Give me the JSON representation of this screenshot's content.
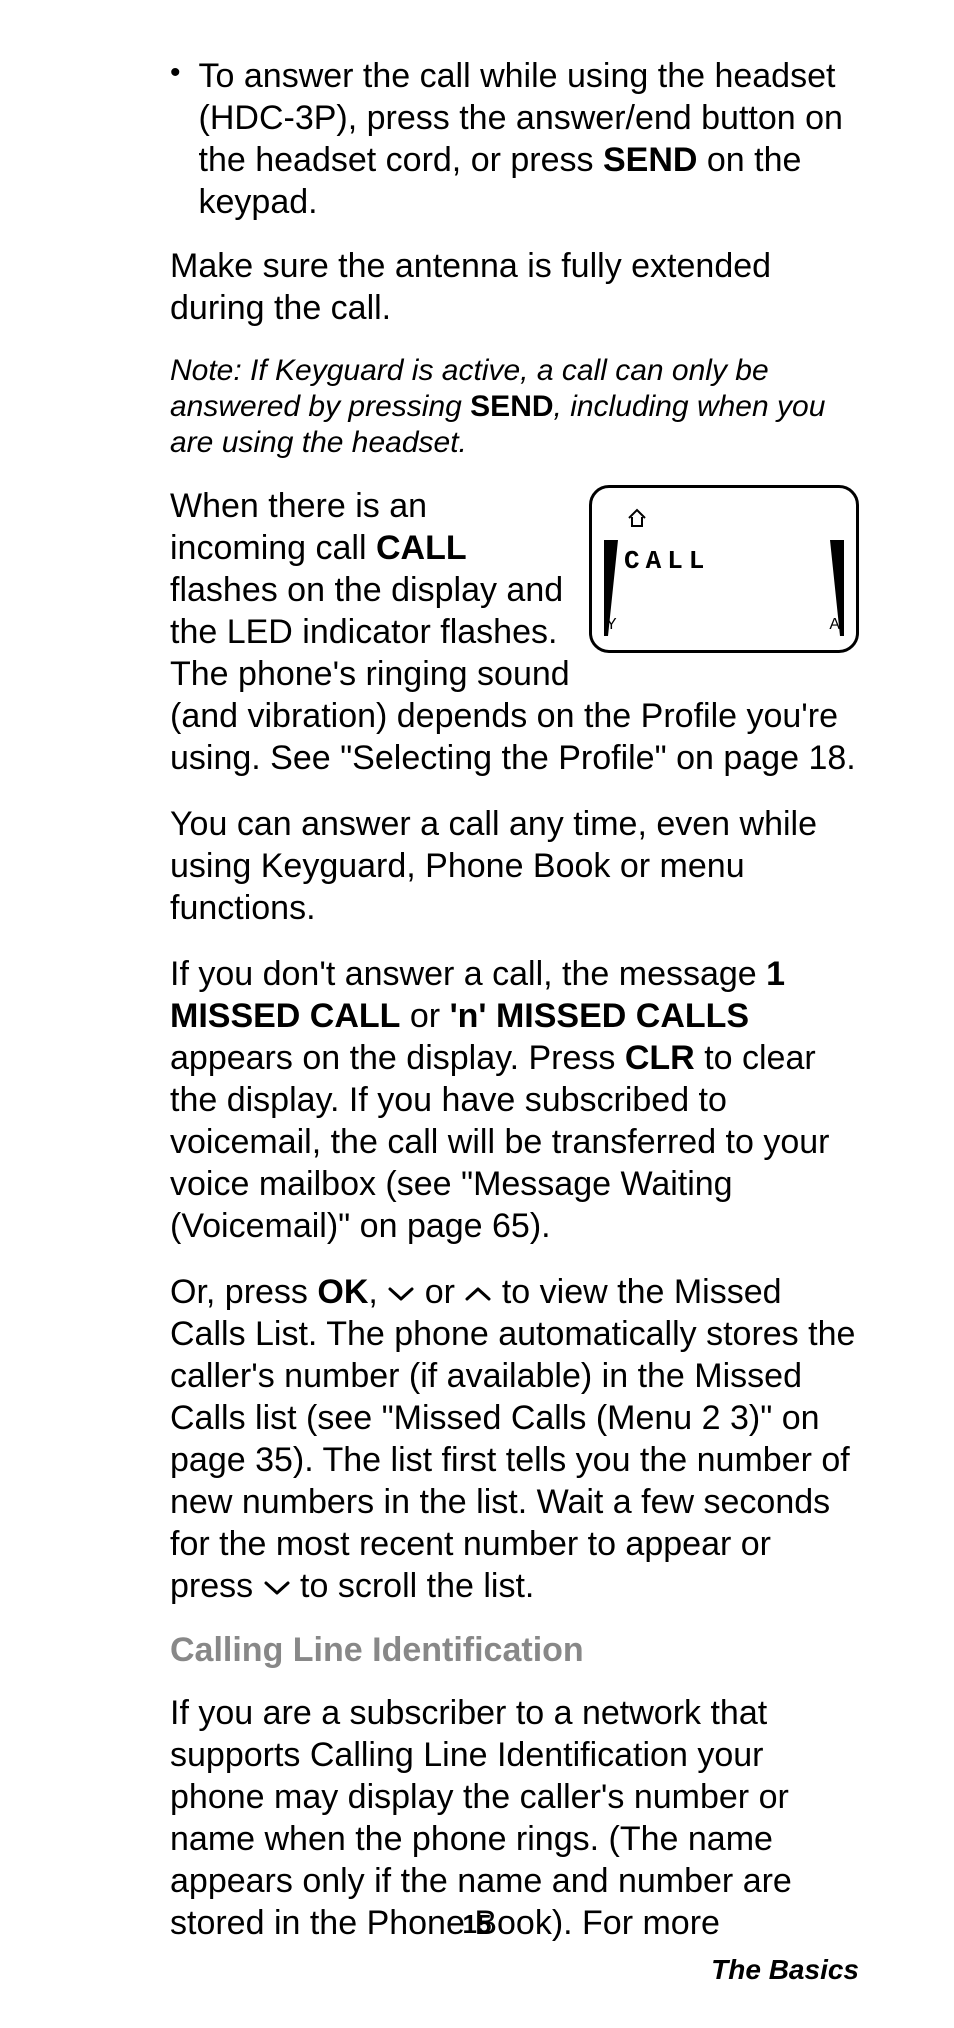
{
  "bullet1_pre": "To answer the call while using the headset (HDC-3P), press the answer/end button on the headset cord, or press ",
  "bullet1_key": "SEND",
  "bullet1_post": " on the keypad.",
  "p_antenna": "Make sure the antenna is fully extended during the call.",
  "note_pre": "Note: If Keyguard is active, a call can only be answered by pressing ",
  "note_key": "SEND",
  "note_post": ", including when you are using the headset.",
  "incoming_pre": "When there is an incoming call ",
  "incoming_bold": "CALL",
  "incoming_post": " flashes on the display and the LED indicator flashes. The phone's ringing sound (and vibration) depends on the Profile you're using. See \"Selecting the Profile\" on page 18.",
  "screen_text": "CALL",
  "screen_left_label": "Y",
  "screen_right_label": "A",
  "p_anytime": "You can answer a call any time, even while using Keyguard, Phone Book or menu functions.",
  "missed_pre": "If you don't answer a call, the message ",
  "missed_b1": "1 MISSED CALL",
  "missed_mid1": " or ",
  "missed_b2": "'n' MISSED CALLS",
  "missed_mid2": " appears on the display. Press ",
  "missed_b3": "CLR",
  "missed_post": " to clear the display. If you have subscribed to voicemail, the call will be transferred to your voice mailbox (see \"Message Waiting (Voicemail)\" on page 65).",
  "or_pre": "Or, press ",
  "or_ok": "OK",
  "or_mid1": ", ",
  "or_mid2": " or ",
  "or_mid3": " to view the Missed Calls List. The phone automatically stores the caller's number (if available) in the Missed Calls list (see \"Missed Calls (Menu 2 3)\" on page 35). The list first tells you the number of new numbers in the list. Wait a few seconds for the most recent number to appear or press ",
  "or_post": " to scroll the list.",
  "heading": "Calling Line Identification",
  "cli_para": "If you are a subscriber to a network that supports Calling Line Identification your phone may display the caller's number or name when the phone rings. (The name appears only if the name and number are stored in the Phone Book). For more",
  "page_number": "15",
  "footer": "The Basics"
}
